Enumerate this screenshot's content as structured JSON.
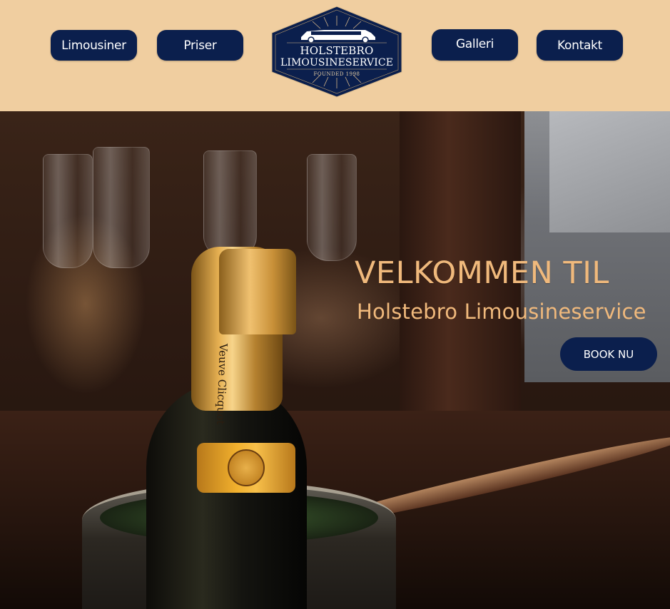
{
  "nav": {
    "limousiner": "Limousiner",
    "priser": "Priser",
    "galleri": "Galleri",
    "kontakt": "Kontakt"
  },
  "logo": {
    "line1": "HOLSTEBRO",
    "line2": "LIMOUSINESERVICE",
    "founded": "FOUNDED 1998"
  },
  "hero": {
    "title": "VELKOMMEN TIL",
    "subtitle": "Holstebro Limousineservice",
    "book_button": "BOOK NU",
    "bottle_label_text": "Veuve Clicquot"
  },
  "colors": {
    "header_bg": "#f0cea0",
    "button_bg": "#0b1f4d",
    "accent_gold": "#f0b97c"
  }
}
